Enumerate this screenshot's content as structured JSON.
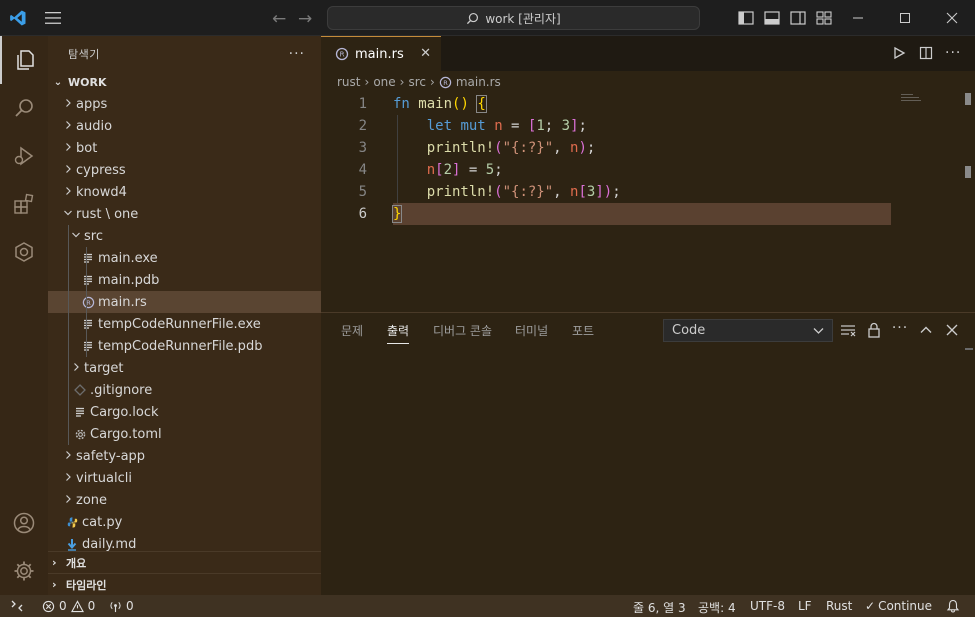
{
  "titlebar": {
    "search_text": "work [관리자]"
  },
  "sidebar": {
    "title": "탐색기",
    "more": "···",
    "section": "WORK",
    "tree": [
      {
        "label": "apps",
        "type": "folder",
        "open": false,
        "depth": 0
      },
      {
        "label": "audio",
        "type": "folder",
        "open": false,
        "depth": 0
      },
      {
        "label": "bot",
        "type": "folder",
        "open": false,
        "depth": 0
      },
      {
        "label": "cypress",
        "type": "folder",
        "open": false,
        "depth": 0
      },
      {
        "label": "knowd4",
        "type": "folder",
        "open": false,
        "depth": 0
      },
      {
        "label": "rust \\ one",
        "type": "folder",
        "open": true,
        "depth": 0
      },
      {
        "label": "src",
        "type": "folder",
        "open": true,
        "depth": 1
      },
      {
        "label": "main.exe",
        "type": "file",
        "depth": 2
      },
      {
        "label": "main.pdb",
        "type": "file",
        "depth": 2
      },
      {
        "label": "main.rs",
        "type": "rust",
        "depth": 2,
        "selected": true
      },
      {
        "label": "tempCodeRunnerFile.exe",
        "type": "file",
        "depth": 2
      },
      {
        "label": "tempCodeRunnerFile.pdb",
        "type": "file",
        "depth": 2
      },
      {
        "label": "target",
        "type": "folder",
        "open": false,
        "depth": 1
      },
      {
        "label": ".gitignore",
        "type": "git",
        "depth": 1
      },
      {
        "label": "Cargo.lock",
        "type": "file",
        "depth": 1
      },
      {
        "label": "Cargo.toml",
        "type": "gear",
        "depth": 1
      },
      {
        "label": "safety-app",
        "type": "folder",
        "open": false,
        "depth": 0
      },
      {
        "label": "virtualcli",
        "type": "folder",
        "open": false,
        "depth": 0
      },
      {
        "label": "zone",
        "type": "folder",
        "open": false,
        "depth": 0
      },
      {
        "label": "cat.py",
        "type": "python",
        "depth": 0
      },
      {
        "label": "daily.md",
        "type": "markdown",
        "depth": 0
      }
    ],
    "outline": "개요",
    "timeline": "타임라인"
  },
  "editor": {
    "tab_label": "main.rs",
    "tab_close": "✕",
    "breadcrumb": [
      "rust",
      "one",
      "src",
      "main.rs"
    ],
    "lines": [
      {
        "n": "1"
      },
      {
        "n": "2"
      },
      {
        "n": "3"
      },
      {
        "n": "4"
      },
      {
        "n": "5"
      },
      {
        "n": "6"
      }
    ]
  },
  "panel": {
    "tabs": [
      "문제",
      "출력",
      "디버그 콘솔",
      "터미널",
      "포트"
    ],
    "active_tab": "출력",
    "output_channel": "Code"
  },
  "status": {
    "errors": "0",
    "warnings": "0",
    "ports": "0",
    "cursor": "줄 6, 열 3",
    "spaces": "공백: 4",
    "encoding": "UTF-8",
    "eol": "LF",
    "language": "Rust",
    "continue": "Continue"
  },
  "colors": {
    "activity_bar": "#362716",
    "sidebar": "#3a2a18",
    "editor": "#2d2313",
    "current_line": "#5a4130",
    "status_bar": "#3f3222"
  }
}
